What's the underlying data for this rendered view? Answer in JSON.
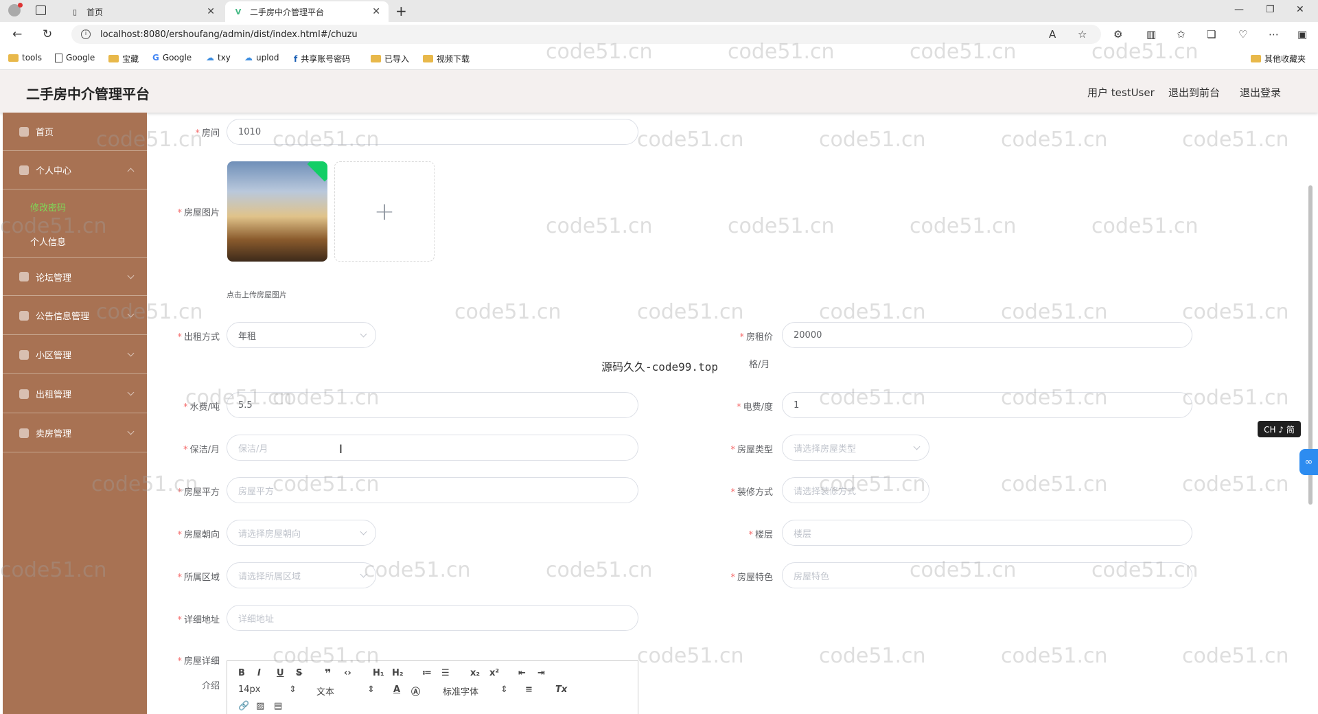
{
  "browser": {
    "tabs": [
      {
        "label": "首页",
        "active": false
      },
      {
        "label": "二手房中介管理平台",
        "active": true
      }
    ],
    "url": "localhost:8080/ershoufang/admin/dist/index.html#/chuzu",
    "bookmarks": [
      "tools",
      "Google",
      "宝藏",
      "Google",
      "txy",
      "uplod",
      "共享账号密码",
      "已导入",
      "视频下载"
    ],
    "other_bookmarks": "其他收藏夹"
  },
  "header": {
    "title": "二手房中介管理平台",
    "user": "用户 testUser",
    "back_to_front": "退出到前台",
    "logout": "退出登录"
  },
  "sidebar": {
    "items": [
      {
        "label": "首页"
      },
      {
        "label": "个人中心"
      },
      {
        "label": "论坛管理"
      },
      {
        "label": "公告信息管理"
      },
      {
        "label": "小区管理"
      },
      {
        "label": "出租管理"
      },
      {
        "label": "卖房管理"
      }
    ],
    "submenu": [
      {
        "label": "修改密码",
        "active": true
      },
      {
        "label": "个人信息",
        "active": false
      }
    ]
  },
  "form": {
    "room": {
      "label": "房间",
      "value": "1010"
    },
    "image": {
      "label": "房屋图片",
      "tip": "点击上传房屋图片"
    },
    "rent_mode": {
      "label": "出租方式",
      "value": "年租"
    },
    "rent_price": {
      "label": "房租价",
      "value": "20000",
      "unit": "格/月"
    },
    "water": {
      "label": "水费/吨",
      "value": "5.5"
    },
    "electric": {
      "label": "电费/度",
      "value": "1"
    },
    "cleaning": {
      "label": "保洁/月",
      "placeholder": "保洁/月"
    },
    "house_type": {
      "label": "房屋类型",
      "placeholder": "请选择房屋类型"
    },
    "area": {
      "label": "房屋平方",
      "placeholder": "房屋平方"
    },
    "decoration": {
      "label": "装修方式",
      "placeholder": "请选择装修方式"
    },
    "orientation": {
      "label": "房屋朝向",
      "placeholder": "请选择房屋朝向"
    },
    "floor": {
      "label": "楼层",
      "placeholder": "楼层"
    },
    "district": {
      "label": "所属区域",
      "placeholder": "请选择所属区域"
    },
    "feature": {
      "label": "房屋特色",
      "placeholder": "房屋特色"
    },
    "address": {
      "label": "详细地址",
      "placeholder": "详细地址"
    },
    "detail": {
      "label_line1": "房屋详细",
      "label_line2": "介绍"
    }
  },
  "editor": {
    "font_size": "14px",
    "text_type": "文本",
    "font_family": "标准字体"
  },
  "overlay": {
    "source_text": "源码久久-code99.top",
    "watermark": "code51.cn",
    "ime": "CH ♪ 简"
  }
}
